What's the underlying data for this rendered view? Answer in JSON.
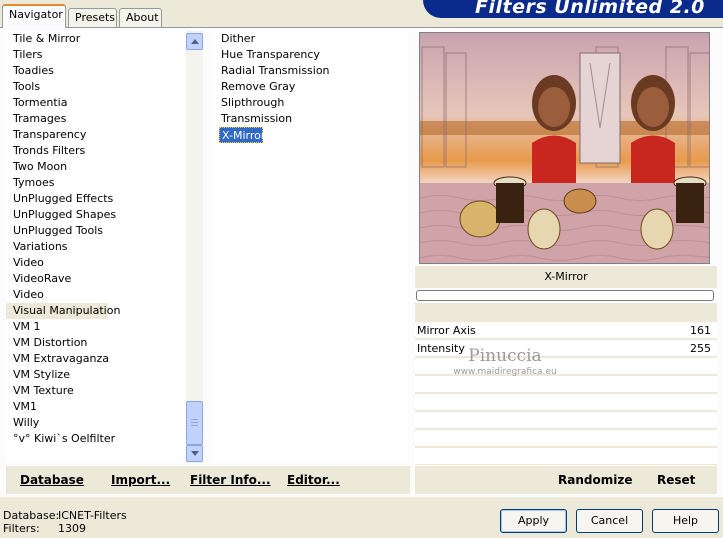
{
  "tabs": [
    {
      "label": "Navigator",
      "active": true
    },
    {
      "label": "Presets",
      "active": false
    },
    {
      "label": "About",
      "active": false
    }
  ],
  "brand": "Filters Unlimited 2.0",
  "categories": [
    "Tile & Mirror",
    "Tilers",
    "Toadies",
    "Tools",
    "Tormentia",
    "Tramages",
    "Transparency",
    "Tronds Filters",
    "Two Moon",
    "Tymoes",
    "UnPlugged Effects",
    "UnPlugged Shapes",
    "UnPlugged Tools",
    "Variations",
    "Video",
    "VideoRave",
    "Video",
    "Visual Manipulation",
    "VM 1",
    "VM Distortion",
    "VM Extravaganza",
    "VM Stylize",
    "VM Texture",
    "VM1",
    "Willy",
    "°v° Kiwi`s Oelfilter"
  ],
  "selected_category": "Visual Manipulation",
  "filters": [
    "Dither",
    "Hue Transparency",
    "Radial Transmission",
    "Remove Gray",
    "Slipthrough",
    "Transmission",
    "X-Mirror"
  ],
  "selected_filter": "X-Mirror",
  "effect_name": "X-Mirror",
  "controls": [
    {
      "label": "Mirror Axis",
      "value": "161"
    },
    {
      "label": "Intensity",
      "value": "255"
    }
  ],
  "watermark": {
    "line1": "Pinuccia",
    "line2": "www.maidiregrafica.eu"
  },
  "left_buttons": {
    "database": "Database",
    "import": "Import...",
    "filter_info": "Filter Info...",
    "editor": "Editor..."
  },
  "right_buttons": {
    "randomize": "Randomize",
    "reset": "Reset"
  },
  "footer": {
    "database_label": "Database:",
    "database_value": "ICNET-Filters",
    "filters_label": "Filters:",
    "filters_value": "1309"
  },
  "dialog_buttons": {
    "apply": "Apply",
    "cancel": "Cancel",
    "help": "Help"
  },
  "colors": {
    "brand_blue": "#0a2a8c",
    "selection": "#316ac5",
    "tab_accent": "#e68b2c"
  }
}
